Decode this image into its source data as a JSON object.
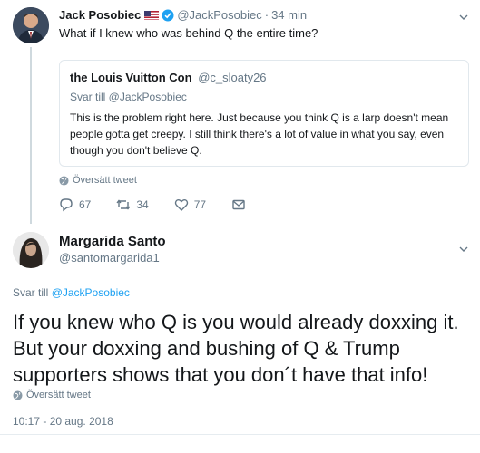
{
  "tweet1": {
    "author_name": "Jack Posobiec",
    "author_handle": "@JackPosobiec",
    "time": "34 min",
    "text": "What if I knew who was behind Q the entire time?",
    "quote": {
      "author_name": "the Louis Vuitton Con",
      "author_handle": "@c_sloaty26",
      "reply_to": "Svar till @JackPosobiec",
      "text": "This is the problem right here. Just because you think Q is a larp doesn't mean people gotta get creepy. I still think there's a lot of value in what you say, even though you don't believe Q."
    },
    "translate_label": "Översätt tweet",
    "reply_count": "67",
    "retweet_count": "34",
    "like_count": "77"
  },
  "tweet2": {
    "author_name": "Margarida Santo",
    "author_handle": "@santomargarida1",
    "reply_prefix": "Svar till",
    "reply_handle": "@JackPosobiec",
    "text": "If you knew who Q is you would already doxxing it. But your doxxing and bushing of Q & Trump supporters shows that you don´t have that info!",
    "translate_label": "Översätt tweet",
    "timestamp": "10:17 - 20 aug. 2018"
  },
  "colors": {
    "accent": "#1da1f2",
    "muted": "#657786",
    "text": "#14171a",
    "border": "#e1e8ed"
  }
}
